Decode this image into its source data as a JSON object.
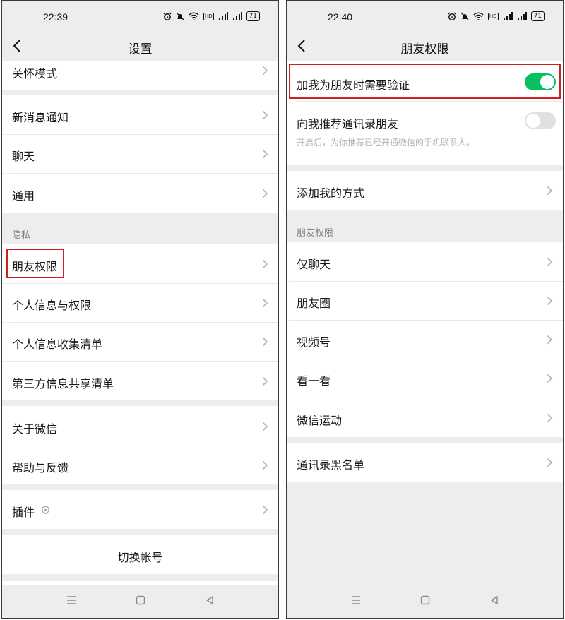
{
  "left": {
    "status": {
      "time": "22:39",
      "battery": "71",
      "signal_label": "5G"
    },
    "title": "设置",
    "items_top": [
      {
        "label": "关怀模式"
      }
    ],
    "group1": [
      {
        "label": "新消息通知"
      },
      {
        "label": "聊天"
      },
      {
        "label": "通用"
      }
    ],
    "privacy_header": "隐私",
    "privacy": [
      {
        "label": "朋友权限"
      },
      {
        "label": "个人信息与权限"
      },
      {
        "label": "个人信息收集清单"
      },
      {
        "label": "第三方信息共享清单"
      }
    ],
    "group3": [
      {
        "label": "关于微信"
      },
      {
        "label": "帮助与反馈"
      }
    ],
    "plugins": {
      "label": "插件"
    },
    "switch_account": "切换帐号"
  },
  "right": {
    "status": {
      "time": "22:40",
      "battery": "71",
      "signal_label": "5G"
    },
    "title": "朋友权限",
    "verify": {
      "label": "加我为朋友时需要验证",
      "on": true
    },
    "recommend": {
      "label": "向我推荐通讯录朋友",
      "on": false,
      "note": "开启后，为你推荐已经开通微信的手机联系人。"
    },
    "add_methods": "添加我的方式",
    "section_header": "朋友权限",
    "perm_items": [
      {
        "label": "仅聊天"
      },
      {
        "label": "朋友圈"
      },
      {
        "label": "视频号"
      },
      {
        "label": "看一看"
      },
      {
        "label": "微信运动"
      }
    ],
    "blacklist": "通讯录黑名单"
  },
  "colors": {
    "toggle_on": "#07c160",
    "toggle_off": "#e0e0e0",
    "highlight": "#d41e1e"
  },
  "icons": [
    "back-arrow-icon",
    "chevron-right-icon",
    "alarm-icon",
    "mute-icon",
    "wifi-icon",
    "signal-icon",
    "battery-icon",
    "shield-icon",
    "menu-icon",
    "home-icon",
    "back-triangle-icon"
  ]
}
